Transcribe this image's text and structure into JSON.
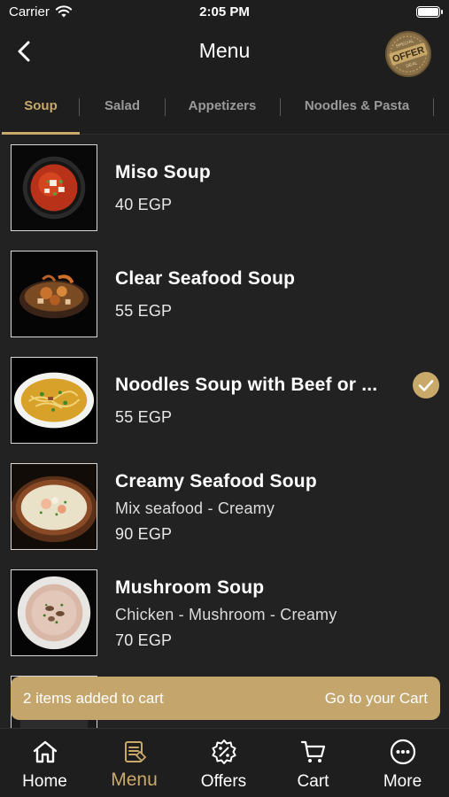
{
  "status_bar": {
    "carrier": "Carrier",
    "time": "2:05 PM"
  },
  "header": {
    "title": "Menu",
    "offer_badge": {
      "top_text": "SPECIAL",
      "main_text": "OFFER",
      "bottom_text": "DEAL"
    }
  },
  "tabs": [
    {
      "label": "Soup",
      "active": true
    },
    {
      "label": "Salad",
      "active": false
    },
    {
      "label": "Appetizers",
      "active": false
    },
    {
      "label": "Noodles & Pasta",
      "active": false
    }
  ],
  "items": [
    {
      "name": "Miso Soup",
      "description": "",
      "price": "40 EGP",
      "selected": false
    },
    {
      "name": "Clear Seafood Soup",
      "description": "",
      "price": "55 EGP",
      "selected": false
    },
    {
      "name": "Noodles Soup with Beef or ...",
      "description": "",
      "price": "55 EGP",
      "selected": true
    },
    {
      "name": "Creamy Seafood Soup",
      "description": "Mix seafood - Creamy",
      "price": "90 EGP",
      "selected": false
    },
    {
      "name": "Mushroom Soup",
      "description": "Chicken - Mushroom - Creamy",
      "price": "70 EGP",
      "selected": false
    }
  ],
  "cart_banner": {
    "message": "2 items added to cart",
    "action": "Go to your Cart"
  },
  "tabbar": [
    {
      "label": "Home",
      "icon": "home-icon"
    },
    {
      "label": "Menu",
      "icon": "menu-icon",
      "active": true
    },
    {
      "label": "Offers",
      "icon": "offers-icon"
    },
    {
      "label": "Cart",
      "icon": "cart-icon"
    },
    {
      "label": "More",
      "icon": "more-icon"
    }
  ],
  "colors": {
    "accent": "#c9a96a",
    "background": "#222222",
    "bar": "#1e1e1e",
    "banner": "#c4a56b"
  }
}
